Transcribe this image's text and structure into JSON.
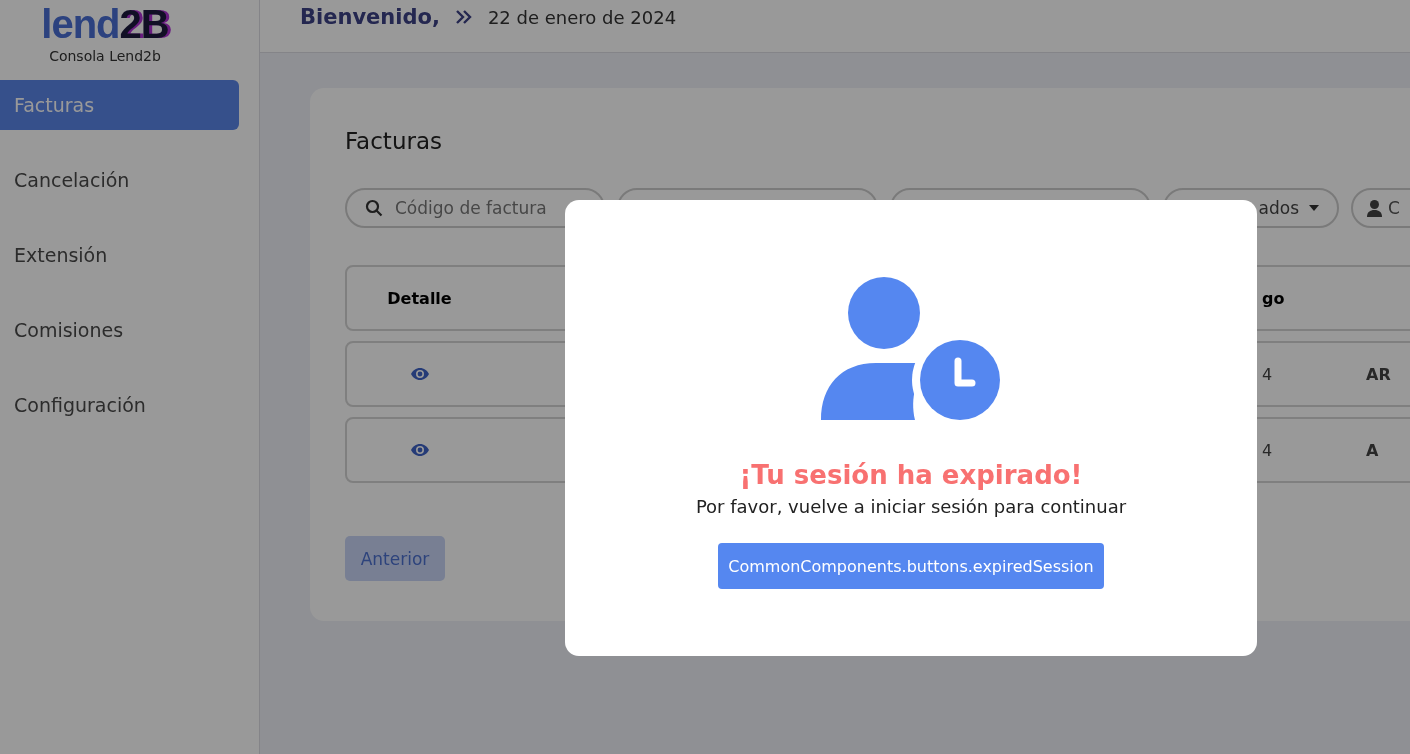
{
  "sidebar": {
    "logo": {
      "first": "lend",
      "second": "2B"
    },
    "subtitle": "Consola Lend2b",
    "items": [
      {
        "label": "Facturas",
        "selected": true
      },
      {
        "label": "Cancelación",
        "selected": false
      },
      {
        "label": "Extensión",
        "selected": false
      },
      {
        "label": "Comisiones",
        "selected": false
      },
      {
        "label": "Configuración",
        "selected": false
      }
    ]
  },
  "header": {
    "greeting": "Bienvenido,",
    "date": "22 de enero de 2024"
  },
  "page": {
    "title": "Facturas",
    "filters": [
      {
        "kind": "search",
        "placeholder": "Código de factura"
      },
      {
        "kind": "field"
      },
      {
        "kind": "field"
      },
      {
        "kind": "dropdown",
        "value": "ados"
      },
      {
        "kind": "user",
        "value": "C"
      }
    ],
    "table": {
      "header": {
        "column_1": "Detalle",
        "column_3": "go"
      },
      "rows": [
        {
          "column_3": "4",
          "column_4": "AR"
        },
        {
          "column_3": "4",
          "column_4": "A"
        }
      ]
    },
    "pagination": {
      "previous": "Anterior"
    }
  },
  "modal": {
    "title": "¡Tu sesión ha expirado!",
    "message": "Por favor, vuelve a iniciar sesión para continuar",
    "button": "CommonComponents.buttons.expiredSession"
  }
}
